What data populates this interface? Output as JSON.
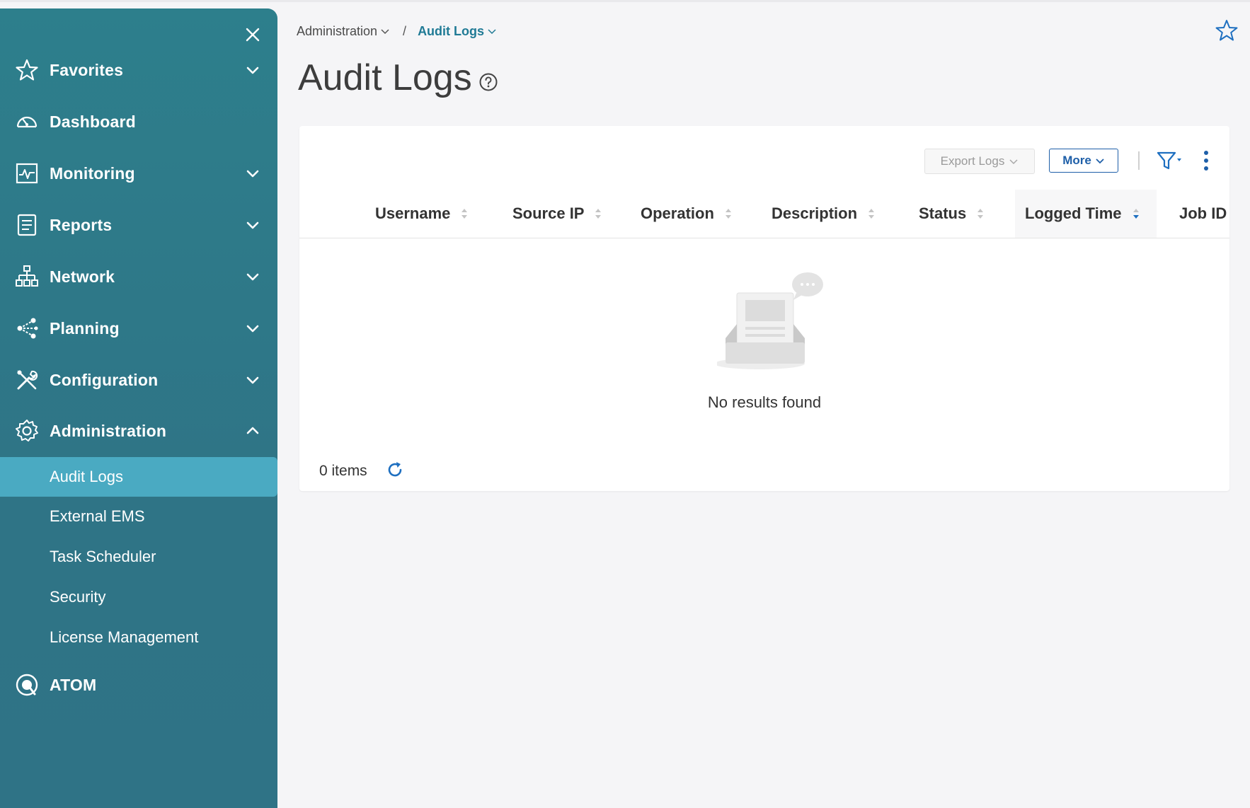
{
  "colors": {
    "sidebar_bg": "#2d7f8c",
    "sidebar_active": "#4aaac2",
    "accent_blue": "#1e5fa8",
    "breadcrumb_current": "#1f7a95",
    "page_bg": "#f5f5f7"
  },
  "sidebar": {
    "close_icon": "close-icon",
    "nav": [
      {
        "label": "Favorites",
        "icon": "star-icon",
        "chevron": "down"
      },
      {
        "label": "Dashboard",
        "icon": "gauge-icon",
        "chevron": null
      },
      {
        "label": "Monitoring",
        "icon": "monitor-pulse-icon",
        "chevron": "down"
      },
      {
        "label": "Reports",
        "icon": "report-icon",
        "chevron": "down"
      },
      {
        "label": "Network",
        "icon": "network-icon",
        "chevron": "down"
      },
      {
        "label": "Planning",
        "icon": "share-nodes-icon",
        "chevron": "down"
      },
      {
        "label": "Configuration",
        "icon": "tools-icon",
        "chevron": "down"
      },
      {
        "label": "Administration",
        "icon": "gear-icon",
        "chevron": "up"
      }
    ],
    "sub_items": [
      {
        "label": "Audit Logs",
        "active": true
      },
      {
        "label": "External EMS",
        "active": false
      },
      {
        "label": "Task Scheduler",
        "active": false
      },
      {
        "label": "Security",
        "active": false
      },
      {
        "label": "License Management",
        "active": false
      }
    ],
    "atom": {
      "label": "ATOM",
      "icon": "atom-icon"
    }
  },
  "breadcrumb": {
    "parent": "Administration",
    "separator": "/",
    "current": "Audit Logs"
  },
  "page": {
    "title": "Audit Logs",
    "help_icon": "help-icon",
    "favorite_icon": "star-outline-icon"
  },
  "toolbar": {
    "export_label": "Export Logs",
    "more_label": "More",
    "filter_icon": "filter-icon",
    "kebab_icon": "kebab-menu-icon"
  },
  "table": {
    "columns": [
      "Username",
      "Source IP",
      "Operation",
      "Description",
      "Status",
      "Logged Time",
      "Job ID"
    ],
    "sorted_column": "Logged Time",
    "empty_text": "No results found",
    "rows": []
  },
  "footer": {
    "items_text": "0 items",
    "refresh_icon": "refresh-icon"
  }
}
